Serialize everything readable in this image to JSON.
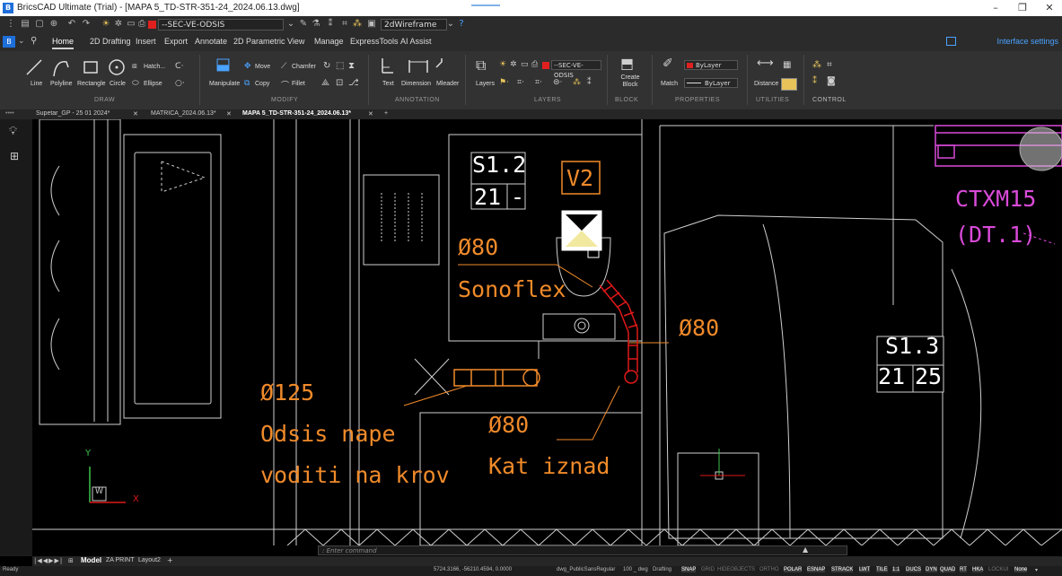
{
  "window": {
    "title": "BricsCAD Ultimate (Trial) - [MAPA 5_TD-STR-351-24_2024.06.13.dwg]",
    "logo_text": "B",
    "minimize": "–",
    "restore": "❐",
    "close": "✕"
  },
  "qat": {
    "layer_value": "--SEC-VE-ODSIS",
    "visual_style": "2dWireframe",
    "layer_color": "#e0201f"
  },
  "ribbon_tabs": [
    "Home",
    "2D Drafting",
    "Insert",
    "Export",
    "Annotate",
    "2D Parametric",
    "View",
    "Manage",
    "ExpressTools",
    "AI Assist"
  ],
  "active_tab": "Home",
  "interface_settings": "Interface settings",
  "ribbon": {
    "draw": {
      "group": "DRAW",
      "line": "Line",
      "polyline": "Polyline",
      "rectangle": "Rectangle",
      "circle": "Circle",
      "hatch": "Hatch...",
      "ellipse": "Ellipse"
    },
    "modify": {
      "group": "MODIFY",
      "manipulate": "Manipulate",
      "move": "Move",
      "copy": "Copy",
      "chamfer": "Chamfer",
      "fillet": "Fillet"
    },
    "annotation": {
      "group": "ANNOTATION",
      "text": "Text",
      "dimension": "Dimension",
      "mleader": "Mleader"
    },
    "layers": {
      "group": "LAYERS",
      "layers": "Layers",
      "current_layer": "--SEC-VE-ODSIS"
    },
    "block": {
      "group": "BLOCK",
      "create_block": "Create Block"
    },
    "properties": {
      "group": "PROPERTIES",
      "match": "Match",
      "color": "ByLayer",
      "linetype": "ByLayer"
    },
    "utilities": {
      "group": "UTILITIES",
      "distance": "Distance"
    },
    "control": {
      "group": "CONTROL"
    }
  },
  "doc_tabs": [
    {
      "label": "Supetar_GP - 25 01 2024*",
      "close": "✕"
    },
    {
      "label": "MATRICA_2024.06.13*",
      "close": "✕"
    },
    {
      "label": "MAPA 5_TD-STR-351-24_2024.06.13*",
      "close": "✕"
    }
  ],
  "new_tab": "+",
  "drawing": {
    "s12_title": "S1.2",
    "s12_a": "21",
    "s12_b": "-",
    "v2": "V2",
    "d80_sonoflex": "Ø80",
    "sonoflex": "Sonoflex",
    "d80_right": "Ø80",
    "s13_title": "S1.3",
    "s13_a": "21",
    "s13_b": "25",
    "d125": "Ø125",
    "odsis1": "Odsis nape",
    "odsis2": "voditi na krov",
    "d80_kat": "Ø80",
    "kat": "Kat iznad",
    "ctxm": "CTXM15",
    "dt": "(DT.1)",
    "ucs_y": "Y",
    "ucs_x": "X",
    "ucs_w": "W",
    "orange": "#f08a2a",
    "magenta": "#d94ad9",
    "red": "#e01818"
  },
  "command": {
    "placeholder": ": Enter command"
  },
  "layout_tabs": [
    "Model",
    "ZA PRINT",
    "Layout2"
  ],
  "layout_add": "+",
  "status": {
    "ready": "Ready",
    "coords": "5724.3166, -56210.4594, 0.0000",
    "font": "dwg_PublicSansRegular",
    "scale": "100 _ dwg",
    "workspace": "Drafting",
    "toggles": [
      "SNAP",
      "GRID",
      "HIDEOBJECTS",
      "ORTHO",
      "POLAR",
      "ESNAP",
      "STRACK",
      "LWT",
      "TILE",
      "1:1",
      "DUCS",
      "DYN",
      "QUAD",
      "RT",
      "HKA",
      "LOCKUI",
      "None"
    ]
  }
}
